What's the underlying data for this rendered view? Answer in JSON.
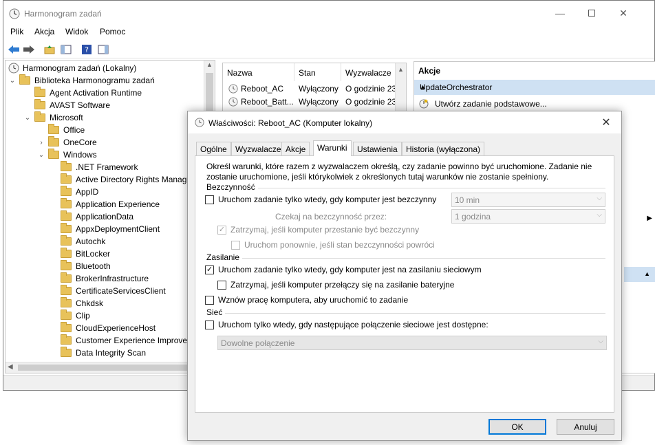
{
  "main": {
    "title": "Harmonogram zadań",
    "menu": [
      "Plik",
      "Akcja",
      "Widok",
      "Pomoc"
    ]
  },
  "tree": {
    "root": "Harmonogram zadań (Lokalny)",
    "library": "Biblioteka Harmonogramu zadań",
    "items": [
      {
        "label": "Agent Activation Runtime",
        "level": 2
      },
      {
        "label": "AVAST Software",
        "level": 2
      },
      {
        "label": "Microsoft",
        "level": 2,
        "expanded": true
      },
      {
        "label": "Office",
        "level": 3
      },
      {
        "label": "OneCore",
        "level": 3,
        "collapsed": true
      },
      {
        "label": "Windows",
        "level": 3,
        "expanded": true
      },
      {
        "label": ".NET Framework",
        "level": 4
      },
      {
        "label": "Active Directory Rights Manage",
        "level": 4
      },
      {
        "label": "AppID",
        "level": 4
      },
      {
        "label": "Application Experience",
        "level": 4
      },
      {
        "label": "ApplicationData",
        "level": 4
      },
      {
        "label": "AppxDeploymentClient",
        "level": 4
      },
      {
        "label": "Autochk",
        "level": 4
      },
      {
        "label": "BitLocker",
        "level": 4
      },
      {
        "label": "Bluetooth",
        "level": 4
      },
      {
        "label": "BrokerInfrastructure",
        "level": 4
      },
      {
        "label": "CertificateServicesClient",
        "level": 4
      },
      {
        "label": "Chkdsk",
        "level": 4
      },
      {
        "label": "Clip",
        "level": 4
      },
      {
        "label": "CloudExperienceHost",
        "level": 4
      },
      {
        "label": "Customer Experience Improven",
        "level": 4
      },
      {
        "label": "Data Integrity Scan",
        "level": 4
      }
    ]
  },
  "tasklist": {
    "columns": [
      "Nazwa",
      "Stan",
      "Wyzwalacze"
    ],
    "rows": [
      {
        "name": "Reboot_AC",
        "state": "Wyłączony",
        "trigger": "O godzinie 23"
      },
      {
        "name": "Reboot_Batt...",
        "state": "Wyłączony",
        "trigger": "O godzinie 23"
      }
    ]
  },
  "actions": {
    "title": "Akcje",
    "group": "UpdateOrchestrator",
    "items": [
      "Utwórz zadanie podstawowe..."
    ]
  },
  "dialog": {
    "title": "Właściwości: Reboot_AC (Komputer lokalny)",
    "tabs": [
      "Ogólne",
      "Wyzwalacze",
      "Akcje",
      "Warunki",
      "Ustawienia",
      "Historia (wyłączona)"
    ],
    "active_tab": "Warunki",
    "intro": "Określ warunki, które razem z wyzwalaczem określą, czy zadanie powinno być uruchomione. Zadanie nie zostanie uruchomione, jeśli którykolwiek z określonych tutaj warunków nie zostanie spełniony.",
    "idle": {
      "label": "Bezczynność",
      "start_only_idle": "Uruchom zadanie tylko wtedy, gdy komputer jest bezczynny",
      "start_only_idle_checked": false,
      "idle_for_value": "10 min",
      "wait_label": "Czekaj na bezczynność przez:",
      "wait_value": "1 godzina",
      "stop_if_not_idle": "Zatrzymaj, jeśli komputer przestanie być bezczynny",
      "stop_if_not_idle_checked": true,
      "restart_if_idle": "Uruchom ponownie, jeśli stan bezczynności powróci",
      "restart_if_idle_checked": false
    },
    "power": {
      "label": "Zasilanie",
      "ac_only": "Uruchom zadanie tylko wtedy, gdy komputer jest na zasilaniu sieciowym",
      "ac_only_checked": true,
      "stop_on_battery": "Zatrzymaj, jeśli komputer przełączy się na zasilanie bateryjne",
      "stop_on_battery_checked": false,
      "wake": "Wznów pracę komputera, aby uruchomić to zadanie",
      "wake_checked": false
    },
    "network": {
      "label": "Sieć",
      "network_only": "Uruchom tylko wtedy, gdy następujące połączenie sieciowe jest dostępne:",
      "network_only_checked": false,
      "connection_value": "Dowolne połączenie"
    },
    "ok": "OK",
    "cancel": "Anuluj"
  }
}
